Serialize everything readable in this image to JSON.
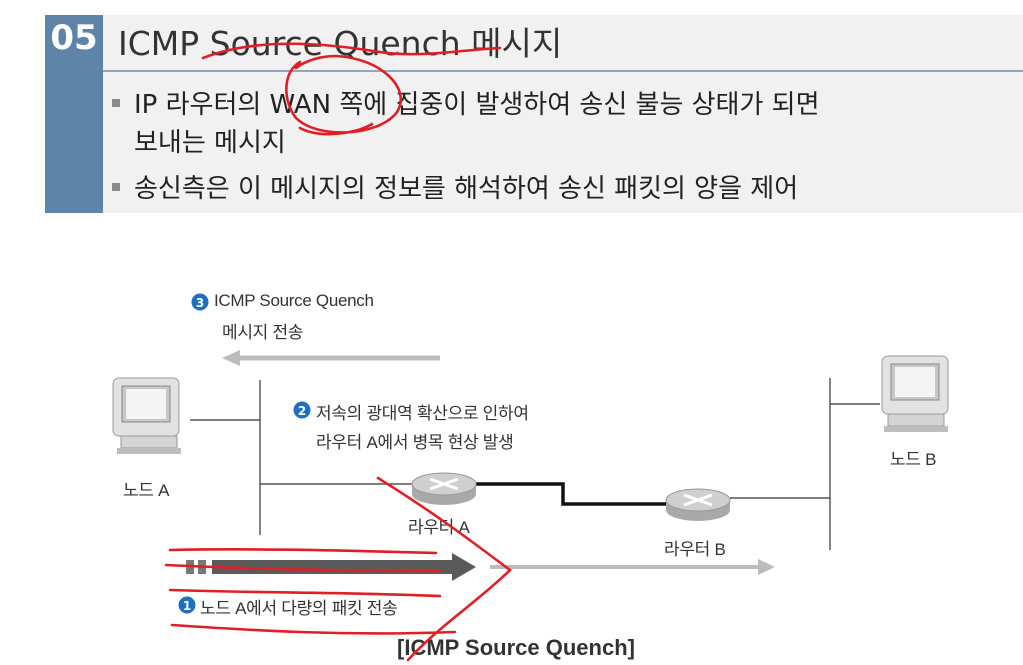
{
  "header": {
    "section_number": "05",
    "title": "ICMP Source Quench 메시지",
    "bullets": [
      "IP 라우터의 WAN 쪽에 집중이 발생하여 송신 불능 상태가 되면",
      "보내는 메시지",
      "송신측은 이 메시지의 정보를 해석하여 송신 패킷의 양을 제어"
    ]
  },
  "diagram": {
    "step3_number": "3",
    "step3_line1": "ICMP Source Quench",
    "step3_line2": "메시지 전송",
    "step2_number": "2",
    "step2_line1": "저속의 광대역 확산으로 인하여",
    "step2_line2": "라우터 A에서 병목 현상 발생",
    "step1_number": "1",
    "step1_text": "노드 A에서 다량의 패킷 전송",
    "node_a": "노드 A",
    "node_b": "노드 B",
    "router_a": "라우터 A",
    "router_b": "라우터 B"
  },
  "caption": "[ICMP Source Quench]",
  "colors": {
    "badge": "#5e84a8",
    "step_circle": "#1f6fc0",
    "annotation": "#e01e26",
    "arrow_gray": "#bcbcbc",
    "arrow_dark": "#5a5a5a"
  }
}
